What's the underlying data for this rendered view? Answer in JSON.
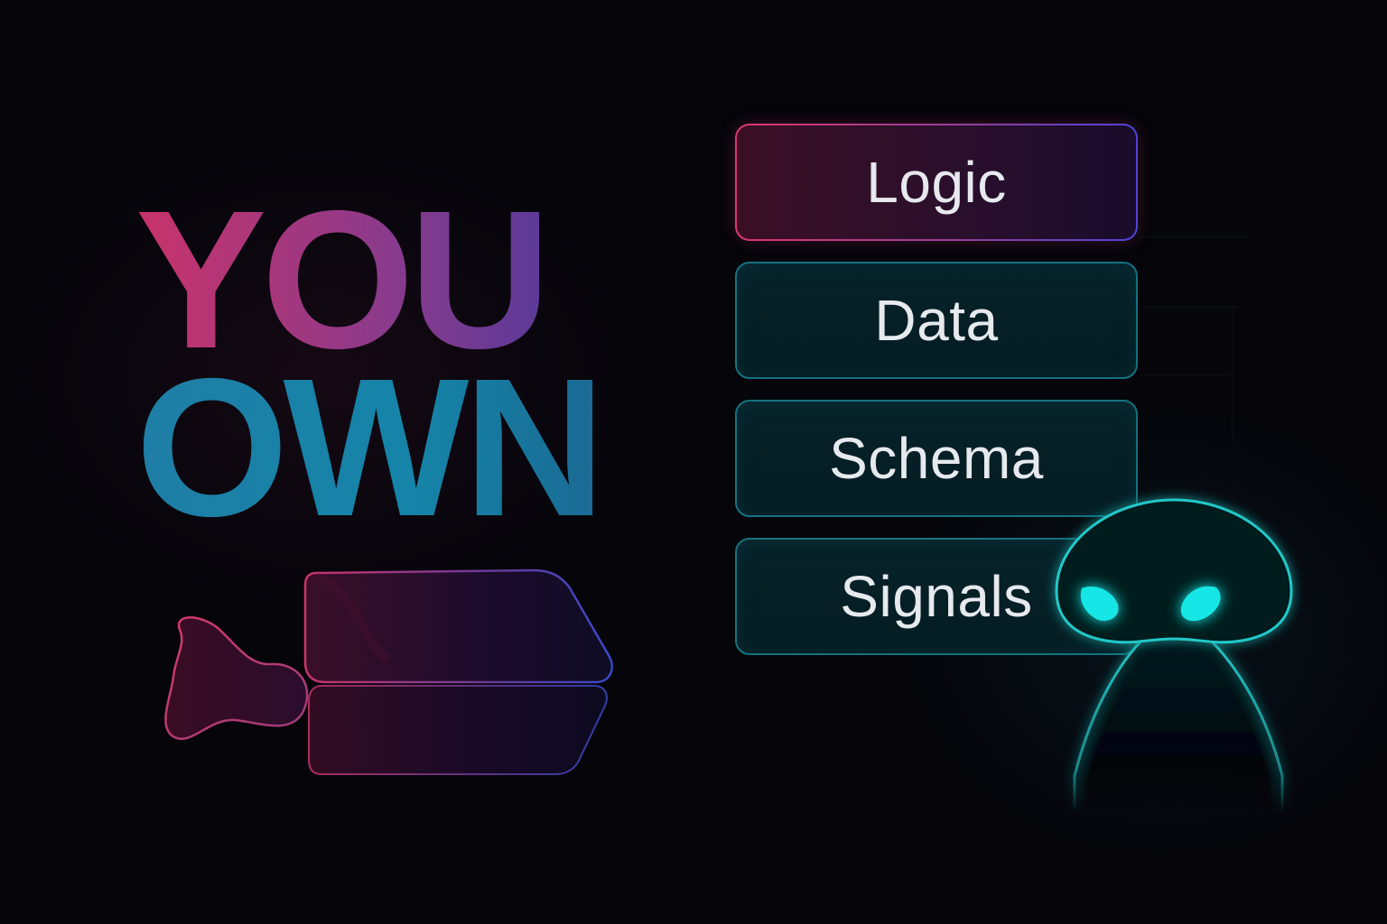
{
  "headline": {
    "line_1": "YOU",
    "line_2": "OWN"
  },
  "stack": {
    "items": [
      {
        "label": "Logic",
        "style": "primary"
      },
      {
        "label": "Data",
        "style": "secondary"
      },
      {
        "label": "Schema",
        "style": "secondary"
      },
      {
        "label": "Signals",
        "style": "secondary"
      }
    ]
  },
  "agent": {
    "icon": "agent-figure-icon",
    "eye_color": "#19e6e6",
    "outline_color": "#1fb8b8"
  },
  "colors": {
    "background": "#05050a",
    "accent_pink": "#e0366f",
    "accent_purple": "#4b44d6",
    "accent_teal": "#167180",
    "text": "#e6e9ee"
  }
}
